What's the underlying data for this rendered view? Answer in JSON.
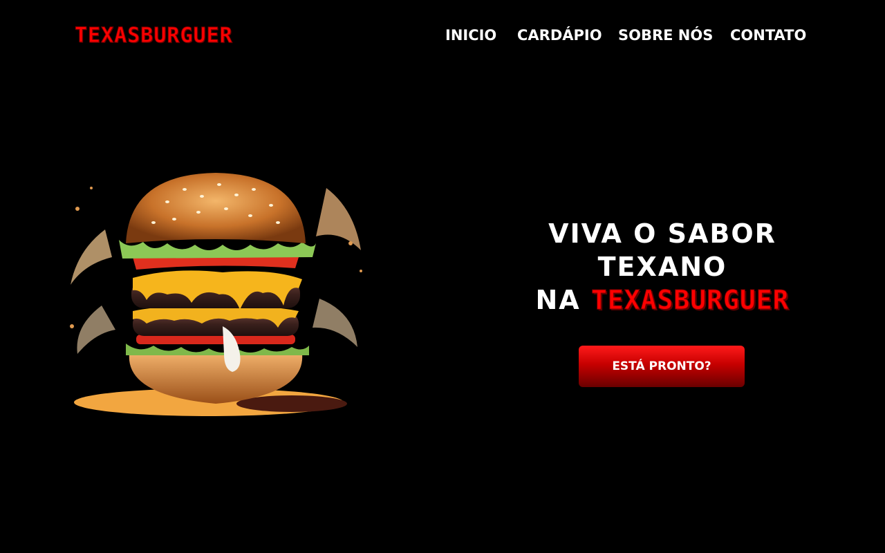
{
  "header": {
    "logo": "TEXASBURGUER",
    "nav": [
      {
        "label": "INICIO"
      },
      {
        "label": "CARDÁPIO"
      },
      {
        "label": "SOBRE NÓS"
      },
      {
        "label": "CONTATO"
      }
    ]
  },
  "hero": {
    "line1": "VIVA O SABOR",
    "line2": "TEXANO",
    "line3_prefix": "NA",
    "line3_brand": "TEXASBURGUER",
    "cta_label": "ESTÁ PRONTO?"
  },
  "colors": {
    "background": "#000000",
    "brand_red": "#ff0000",
    "text": "#ffffff",
    "button_top": "#ff1a1a",
    "button_bottom": "#6a0000"
  }
}
